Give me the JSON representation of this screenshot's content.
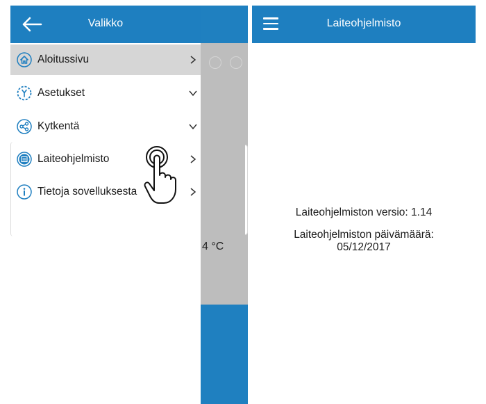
{
  "left_screen": {
    "background_temp_text": "4 °C",
    "drawer": {
      "title": "Valikko",
      "items": [
        {
          "label": "Aloitussivu",
          "icon": "home-icon",
          "chevron": "right",
          "active": true
        },
        {
          "label": "Asetukset",
          "icon": "settings-icon",
          "chevron": "down",
          "active": false
        },
        {
          "label": "Kytkentä",
          "icon": "share-icon",
          "chevron": "down",
          "active": false
        },
        {
          "label": "Laiteohjelmisto",
          "icon": "firmware-chip-icon",
          "chevron": "right",
          "active": false
        },
        {
          "label": "Tietoja sovelluksesta",
          "icon": "info-icon",
          "chevron": "right",
          "active": false
        }
      ]
    }
  },
  "right_screen": {
    "title": "Laiteohjelmisto",
    "version_text": "Laiteohjelmiston versio: 1.14",
    "date_label": "Laiteohjelmiston päivämäärä:",
    "date_value": "05/12/2017"
  },
  "colors": {
    "header_blue": "#1e7fc0",
    "icon_blue": "#1f7fc0",
    "active_row": "#d6d6d6",
    "dim_overlay": "#bdbdbd"
  }
}
